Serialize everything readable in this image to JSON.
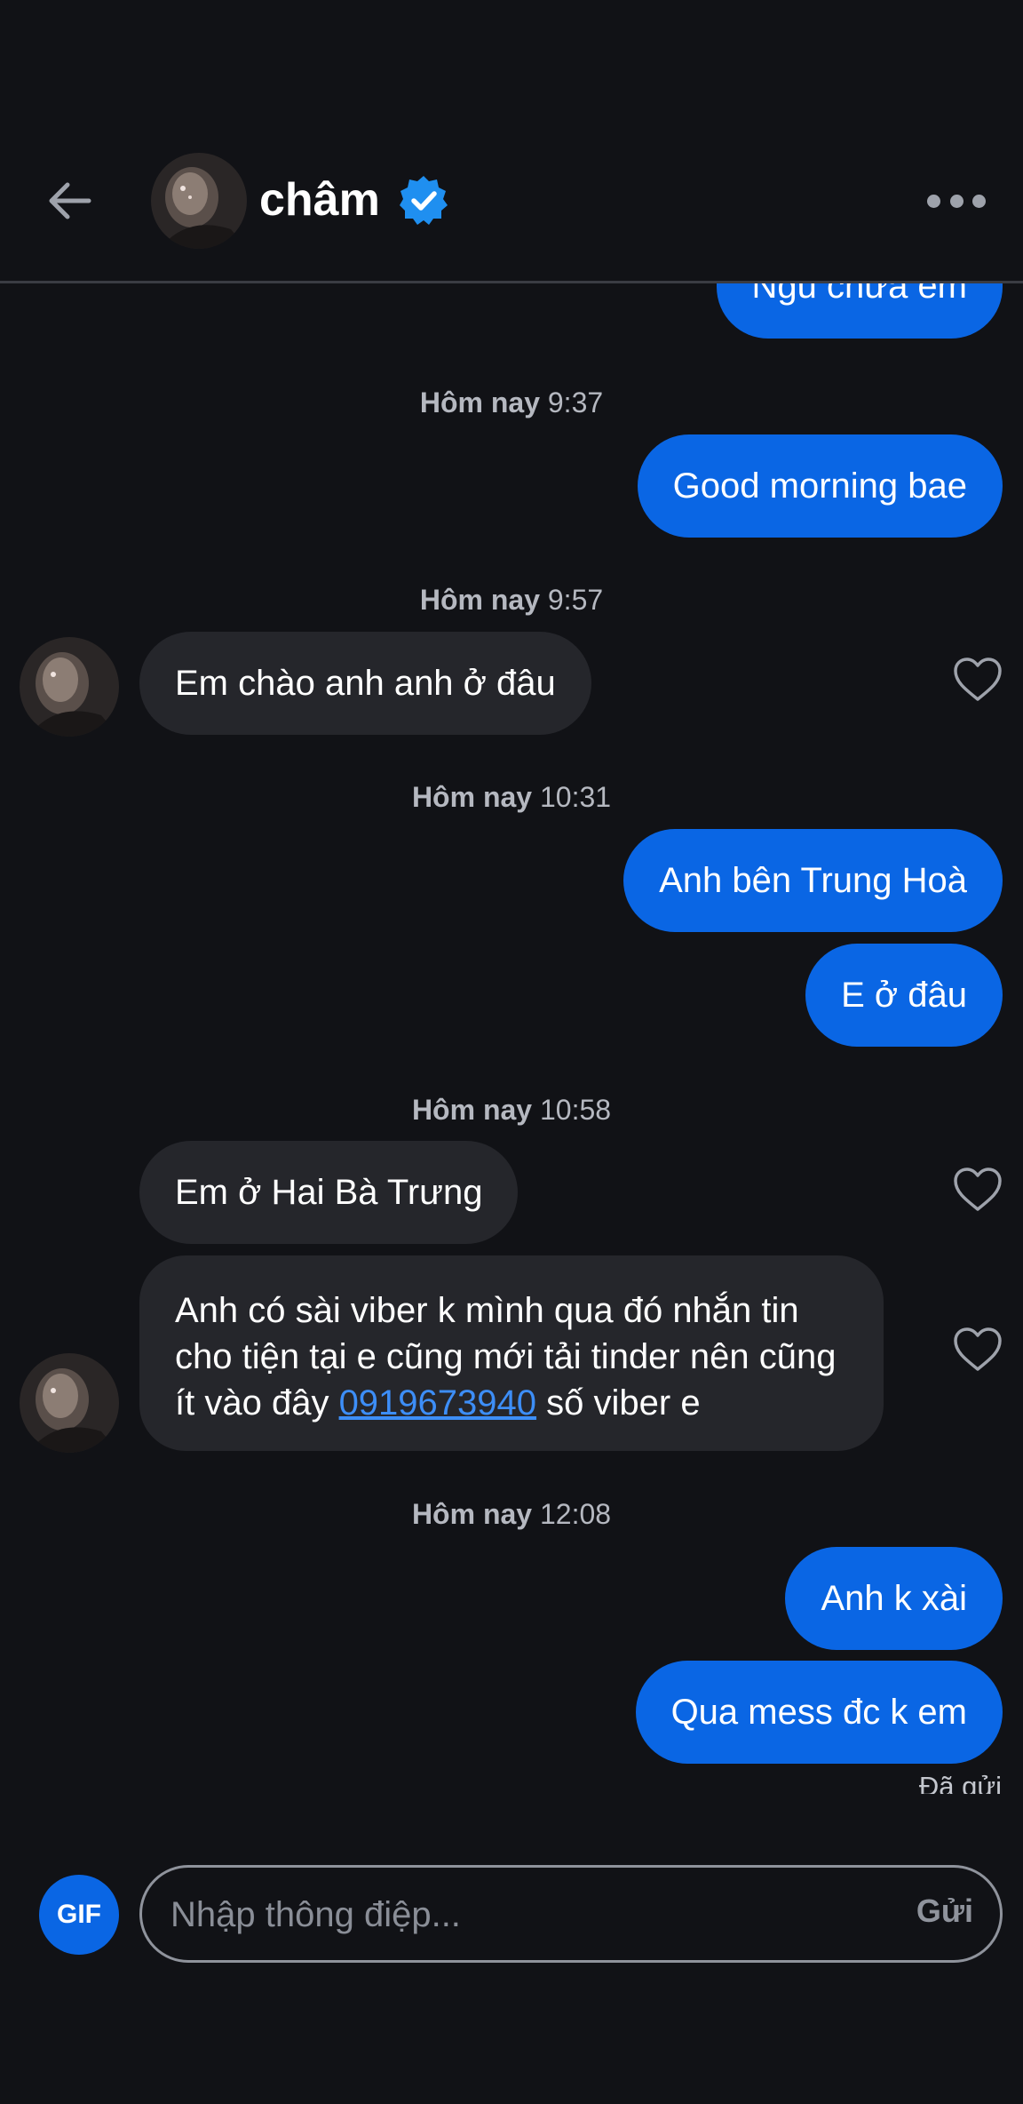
{
  "header": {
    "contact_name": "châm",
    "back_icon": "arrow-left-icon",
    "verified_icon": "verified-badge-icon",
    "more_icon": "more-horizontal-icon"
  },
  "messages": {
    "m0": {
      "text": "Ngủ chưa em"
    },
    "ts1": {
      "day": "Hôm nay",
      "time": "9:37"
    },
    "m1": {
      "text": "Good morning bae"
    },
    "ts2": {
      "day": "Hôm nay",
      "time": "9:57"
    },
    "m2": {
      "text": "Em chào anh anh ở đâu"
    },
    "ts3": {
      "day": "Hôm nay",
      "time": "10:31"
    },
    "m3": {
      "text": "Anh bên Trung Hoà"
    },
    "m4": {
      "text": "E ở đâu"
    },
    "ts4": {
      "day": "Hôm nay",
      "time": "10:58"
    },
    "m5": {
      "text": "Em ở Hai Bà Trưng"
    },
    "m6": {
      "text_before": "Anh có sài viber k mình qua đó nhắn tin cho tiện tại e cũng mới tải tinder nên cũng ít vào đây ",
      "phone": "0919673940",
      "text_after": " số viber e"
    },
    "ts5": {
      "day": "Hôm nay",
      "time": "12:08"
    },
    "m7": {
      "text": "Anh k xài"
    },
    "m8": {
      "text": "Qua mess đc k em"
    },
    "status": "Đã gửi"
  },
  "composer": {
    "gif_label": "GIF",
    "placeholder": "Nhập thông điệp...",
    "send_label": "Gửi"
  },
  "colors": {
    "background": "#111216",
    "outgoing_bubble": "#0a66e4",
    "incoming_bubble": "#25262b",
    "link": "#3d8ef7"
  }
}
